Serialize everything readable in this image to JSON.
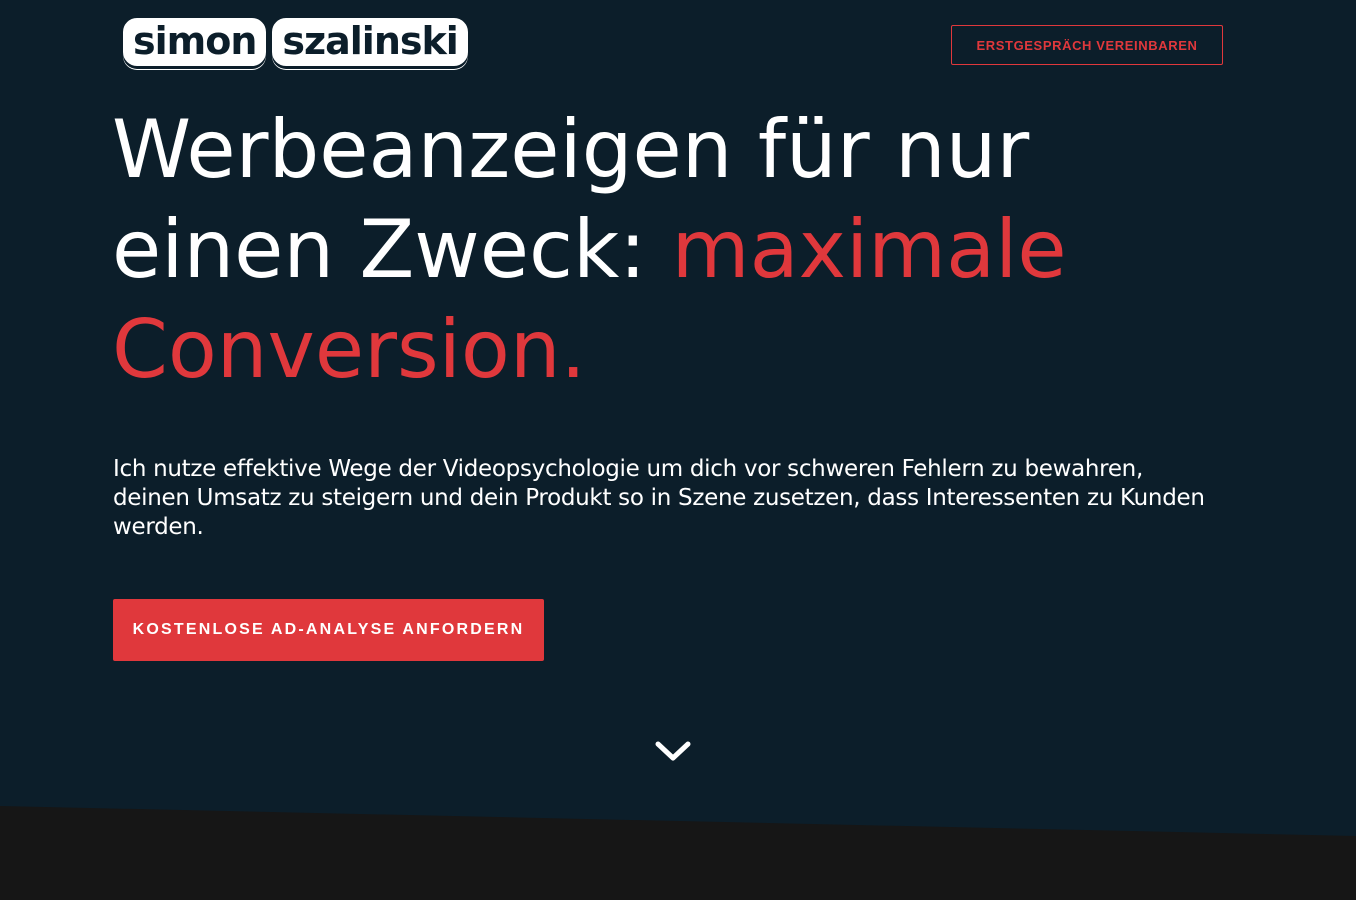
{
  "header": {
    "logo_first": "simon",
    "logo_second": "szalinski",
    "cta_label": "ERSTGESPRÄCH VEREINBAREN"
  },
  "hero": {
    "headline_white_1": "Werbeanzeigen für nur",
    "headline_white_2": "einen Zweck: ",
    "headline_accent_1": "maximale",
    "headline_accent_2": "Conversion.",
    "subtext": "Ich nutze effektive Wege der Videopsychologie um dich vor schweren Fehlern zu bewahren, deinen Umsatz zu steigern und dein Produkt so in Szene zusetzen, dass Interessenten zu Kunden werden.",
    "cta_label": "KOSTENLOSE AD-ANALYSE ANFORDERN",
    "scroll_icon": "chevron-down-icon"
  },
  "colors": {
    "background": "#0c1e2a",
    "accent": "#e0383c",
    "text": "#ffffff",
    "next_section": "#161616"
  }
}
